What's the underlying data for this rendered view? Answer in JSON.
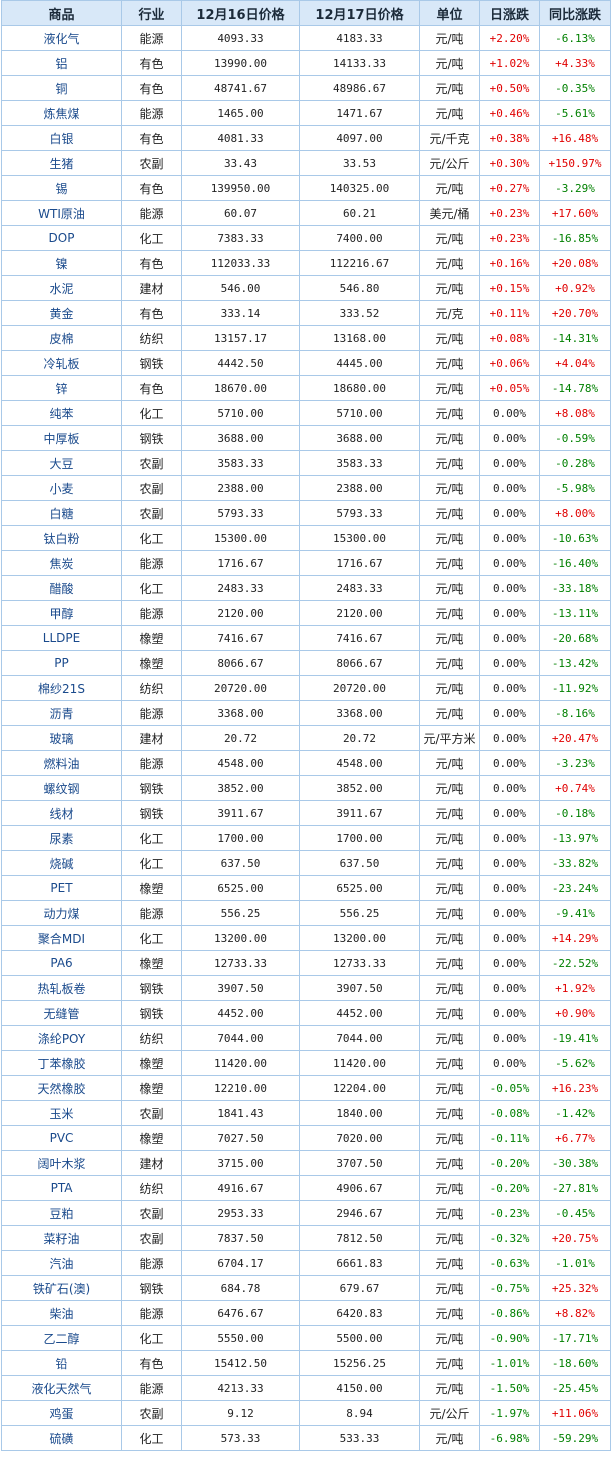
{
  "headers": [
    "商品",
    "行业",
    "12月16日价格",
    "12月17日价格",
    "单位",
    "日涨跌",
    "同比涨跌"
  ],
  "rows": [
    [
      "液化气",
      "能源",
      "4093.33",
      "4183.33",
      "元/吨",
      "+2.20%",
      "-6.13%"
    ],
    [
      "铝",
      "有色",
      "13990.00",
      "14133.33",
      "元/吨",
      "+1.02%",
      "+4.33%"
    ],
    [
      "铜",
      "有色",
      "48741.67",
      "48986.67",
      "元/吨",
      "+0.50%",
      "-0.35%"
    ],
    [
      "炼焦煤",
      "能源",
      "1465.00",
      "1471.67",
      "元/吨",
      "+0.46%",
      "-5.61%"
    ],
    [
      "白银",
      "有色",
      "4081.33",
      "4097.00",
      "元/千克",
      "+0.38%",
      "+16.48%"
    ],
    [
      "生猪",
      "农副",
      "33.43",
      "33.53",
      "元/公斤",
      "+0.30%",
      "+150.97%"
    ],
    [
      "锡",
      "有色",
      "139950.00",
      "140325.00",
      "元/吨",
      "+0.27%",
      "-3.29%"
    ],
    [
      "WTI原油",
      "能源",
      "60.07",
      "60.21",
      "美元/桶",
      "+0.23%",
      "+17.60%"
    ],
    [
      "DOP",
      "化工",
      "7383.33",
      "7400.00",
      "元/吨",
      "+0.23%",
      "-16.85%"
    ],
    [
      "镍",
      "有色",
      "112033.33",
      "112216.67",
      "元/吨",
      "+0.16%",
      "+20.08%"
    ],
    [
      "水泥",
      "建材",
      "546.00",
      "546.80",
      "元/吨",
      "+0.15%",
      "+0.92%"
    ],
    [
      "黄金",
      "有色",
      "333.14",
      "333.52",
      "元/克",
      "+0.11%",
      "+20.70%"
    ],
    [
      "皮棉",
      "纺织",
      "13157.17",
      "13168.00",
      "元/吨",
      "+0.08%",
      "-14.31%"
    ],
    [
      "冷轧板",
      "钢铁",
      "4442.50",
      "4445.00",
      "元/吨",
      "+0.06%",
      "+4.04%"
    ],
    [
      "锌",
      "有色",
      "18670.00",
      "18680.00",
      "元/吨",
      "+0.05%",
      "-14.78%"
    ],
    [
      "纯苯",
      "化工",
      "5710.00",
      "5710.00",
      "元/吨",
      "0.00%",
      "+8.08%"
    ],
    [
      "中厚板",
      "钢铁",
      "3688.00",
      "3688.00",
      "元/吨",
      "0.00%",
      "-0.59%"
    ],
    [
      "大豆",
      "农副",
      "3583.33",
      "3583.33",
      "元/吨",
      "0.00%",
      "-0.28%"
    ],
    [
      "小麦",
      "农副",
      "2388.00",
      "2388.00",
      "元/吨",
      "0.00%",
      "-5.98%"
    ],
    [
      "白糖",
      "农副",
      "5793.33",
      "5793.33",
      "元/吨",
      "0.00%",
      "+8.00%"
    ],
    [
      "钛白粉",
      "化工",
      "15300.00",
      "15300.00",
      "元/吨",
      "0.00%",
      "-10.63%"
    ],
    [
      "焦炭",
      "能源",
      "1716.67",
      "1716.67",
      "元/吨",
      "0.00%",
      "-16.40%"
    ],
    [
      "醋酸",
      "化工",
      "2483.33",
      "2483.33",
      "元/吨",
      "0.00%",
      "-33.18%"
    ],
    [
      "甲醇",
      "能源",
      "2120.00",
      "2120.00",
      "元/吨",
      "0.00%",
      "-13.11%"
    ],
    [
      "LLDPE",
      "橡塑",
      "7416.67",
      "7416.67",
      "元/吨",
      "0.00%",
      "-20.68%"
    ],
    [
      "PP",
      "橡塑",
      "8066.67",
      "8066.67",
      "元/吨",
      "0.00%",
      "-13.42%"
    ],
    [
      "棉纱21S",
      "纺织",
      "20720.00",
      "20720.00",
      "元/吨",
      "0.00%",
      "-11.92%"
    ],
    [
      "沥青",
      "能源",
      "3368.00",
      "3368.00",
      "元/吨",
      "0.00%",
      "-8.16%"
    ],
    [
      "玻璃",
      "建材",
      "20.72",
      "20.72",
      "元/平方米",
      "0.00%",
      "+20.47%"
    ],
    [
      "燃料油",
      "能源",
      "4548.00",
      "4548.00",
      "元/吨",
      "0.00%",
      "-3.23%"
    ],
    [
      "螺纹钢",
      "钢铁",
      "3852.00",
      "3852.00",
      "元/吨",
      "0.00%",
      "+0.74%"
    ],
    [
      "线材",
      "钢铁",
      "3911.67",
      "3911.67",
      "元/吨",
      "0.00%",
      "-0.18%"
    ],
    [
      "尿素",
      "化工",
      "1700.00",
      "1700.00",
      "元/吨",
      "0.00%",
      "-13.97%"
    ],
    [
      "烧碱",
      "化工",
      "637.50",
      "637.50",
      "元/吨",
      "0.00%",
      "-33.82%"
    ],
    [
      "PET",
      "橡塑",
      "6525.00",
      "6525.00",
      "元/吨",
      "0.00%",
      "-23.24%"
    ],
    [
      "动力煤",
      "能源",
      "556.25",
      "556.25",
      "元/吨",
      "0.00%",
      "-9.41%"
    ],
    [
      "聚合MDI",
      "化工",
      "13200.00",
      "13200.00",
      "元/吨",
      "0.00%",
      "+14.29%"
    ],
    [
      "PA6",
      "橡塑",
      "12733.33",
      "12733.33",
      "元/吨",
      "0.00%",
      "-22.52%"
    ],
    [
      "热轧板卷",
      "钢铁",
      "3907.50",
      "3907.50",
      "元/吨",
      "0.00%",
      "+1.92%"
    ],
    [
      "无缝管",
      "钢铁",
      "4452.00",
      "4452.00",
      "元/吨",
      "0.00%",
      "+0.90%"
    ],
    [
      "涤纶POY",
      "纺织",
      "7044.00",
      "7044.00",
      "元/吨",
      "0.00%",
      "-19.41%"
    ],
    [
      "丁苯橡胶",
      "橡塑",
      "11420.00",
      "11420.00",
      "元/吨",
      "0.00%",
      "-5.62%"
    ],
    [
      "天然橡胶",
      "橡塑",
      "12210.00",
      "12204.00",
      "元/吨",
      "-0.05%",
      "+16.23%"
    ],
    [
      "玉米",
      "农副",
      "1841.43",
      "1840.00",
      "元/吨",
      "-0.08%",
      "-1.42%"
    ],
    [
      "PVC",
      "橡塑",
      "7027.50",
      "7020.00",
      "元/吨",
      "-0.11%",
      "+6.77%"
    ],
    [
      "阔叶木浆",
      "建材",
      "3715.00",
      "3707.50",
      "元/吨",
      "-0.20%",
      "-30.38%"
    ],
    [
      "PTA",
      "纺织",
      "4916.67",
      "4906.67",
      "元/吨",
      "-0.20%",
      "-27.81%"
    ],
    [
      "豆粕",
      "农副",
      "2953.33",
      "2946.67",
      "元/吨",
      "-0.23%",
      "-0.45%"
    ],
    [
      "菜籽油",
      "农副",
      "7837.50",
      "7812.50",
      "元/吨",
      "-0.32%",
      "+20.75%"
    ],
    [
      "汽油",
      "能源",
      "6704.17",
      "6661.83",
      "元/吨",
      "-0.63%",
      "-1.01%"
    ],
    [
      "铁矿石(澳)",
      "钢铁",
      "684.78",
      "679.67",
      "元/吨",
      "-0.75%",
      "+25.32%"
    ],
    [
      "柴油",
      "能源",
      "6476.67",
      "6420.83",
      "元/吨",
      "-0.86%",
      "+8.82%"
    ],
    [
      "乙二醇",
      "化工",
      "5550.00",
      "5500.00",
      "元/吨",
      "-0.90%",
      "-17.71%"
    ],
    [
      "铅",
      "有色",
      "15412.50",
      "15256.25",
      "元/吨",
      "-1.01%",
      "-18.60%"
    ],
    [
      "液化天然气",
      "能源",
      "4213.33",
      "4150.00",
      "元/吨",
      "-1.50%",
      "-25.45%"
    ],
    [
      "鸡蛋",
      "农副",
      "9.12",
      "8.94",
      "元/公斤",
      "-1.97%",
      "+11.06%"
    ],
    [
      "硫磺",
      "化工",
      "573.33",
      "533.33",
      "元/吨",
      "-6.98%",
      "-59.29%"
    ]
  ],
  "colors": {
    "header_bg": "#d8e8f8",
    "border": "#a9c9e8",
    "name_text": "#1a4a8c",
    "up": "#e00000",
    "down": "#008000"
  }
}
